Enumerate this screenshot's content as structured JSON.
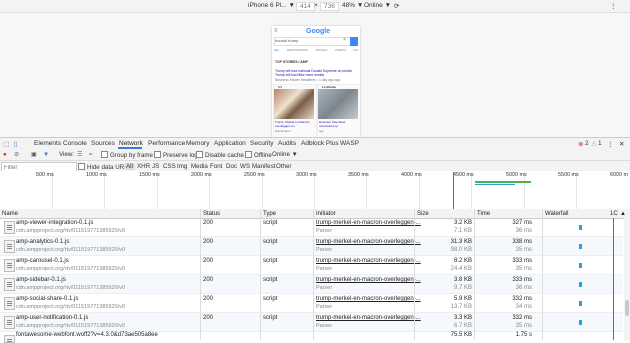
{
  "device_toolbar": {
    "device": "iPhone 6 Pl... ▼",
    "width": "414",
    "times": "×",
    "height": "736",
    "zoom": "48% ▼",
    "network": "Online ▼"
  },
  "phone": {
    "logo": "Google",
    "search_value": "donald trump",
    "tabs": [
      "ALL",
      "NEWS/IMAGES",
      "IMAGES",
      "VIDEOS",
      "MA"
    ],
    "section": "TOP STORIES / AMP",
    "story1": "Trump will lose national Donald Supreme on media Trump will lost Mike more worlds",
    "story1_src": "Business Insider Headlines • 1 day ago ago",
    "card_sources": [
      "NS",
      "Le Monde"
    ],
    "cap1": "Trump, Merkel en Macron: overleggen om",
    "cap2": "Directeur Tata Steel verrassend op",
    "cap1_src": "Washington",
    "cap2_src": "ago"
  },
  "devtools_tabs": [
    "Elements",
    "Console",
    "Sources",
    "Network",
    "Performance",
    "Memory",
    "Application",
    "Security",
    "Audits",
    "Adblock Plus",
    "WASP"
  ],
  "errors": "2",
  "warnings": "1",
  "net_toolbar": {
    "view": "View:",
    "group": "Group by frame",
    "preserve": "Preserve log",
    "cache": "Disable cache",
    "offline": "Offline",
    "online": "Online ▼"
  },
  "filter": {
    "placeholder": "Filter",
    "hide_data": "Hide data URLs",
    "types": [
      "All",
      "XHR",
      "JS",
      "CSS",
      "Img",
      "Media",
      "Font",
      "Doc",
      "WS",
      "Manifest",
      "Other"
    ]
  },
  "timeline_ticks": [
    "500 ms",
    "1000 ms",
    "1500 ms",
    "2000 ms",
    "2500 ms",
    "3000 ms",
    "3500 ms",
    "4000 ms",
    "4500 ms",
    "5000 ms",
    "5500 ms",
    "6000 m"
  ],
  "columns": {
    "name": "Name",
    "status": "Status",
    "type": "Type",
    "initiator": "Initiator",
    "size": "Size",
    "time": "Time",
    "waterfall": "Waterfall",
    "sort": "1C"
  },
  "rows": [
    {
      "name": "amp-viewer-integration-0.1.js",
      "domain": "cdn.ampproject.org/rtv/011519771385920/v0",
      "status": "200",
      "type": "script",
      "initiator": "trump-merkel-en-macron-overleggen-...",
      "initiator_sub": "Parser",
      "size": "3.2 KB",
      "size2": "7.1 KB",
      "time": "327 ms",
      "time2": "36 ms"
    },
    {
      "name": "amp-analytics-0.1.js",
      "domain": "cdn.ampproject.org/rtv/011519771385920/v0",
      "status": "200",
      "type": "script",
      "initiator": "trump-merkel-en-macron-overleggen-...",
      "initiator_sub": "Parser",
      "size": "31.3 KB",
      "size2": "98.0 KB",
      "time": "338 ms",
      "time2": "35 ms"
    },
    {
      "name": "amp-carousel-0.1.js",
      "domain": "cdn.ampproject.org/rtv/011519771385920/v0",
      "status": "200",
      "type": "script",
      "initiator": "trump-merkel-en-macron-overleggen-...",
      "initiator_sub": "Parser",
      "size": "8.2 KB",
      "size2": "24.4 KB",
      "time": "333 ms",
      "time2": "35 ms"
    },
    {
      "name": "amp-sidebar-0.1.js",
      "domain": "cdn.ampproject.org/rtv/011519771385920/v0",
      "status": "200",
      "type": "script",
      "initiator": "trump-merkel-en-macron-overleggen-...",
      "initiator_sub": "Parser",
      "size": "3.8 KB",
      "size2": "9.7 KB",
      "time": "333 ms",
      "time2": "36 ms"
    },
    {
      "name": "amp-social-share-0.1.js",
      "domain": "cdn.ampproject.org/rtv/011519771385920/v0",
      "status": "200",
      "type": "script",
      "initiator": "trump-merkel-en-macron-overleggen-...",
      "initiator_sub": "Parser",
      "size": "5.9 KB",
      "size2": "13.7 KB",
      "time": "332 ms",
      "time2": "34 ms"
    },
    {
      "name": "amp-user-notification-0.1.js",
      "domain": "cdn.ampproject.org/rtv/011519771385920/v0",
      "status": "200",
      "type": "script",
      "initiator": "trump-merkel-en-macron-overleggen-...",
      "initiator_sub": "Parser",
      "size": "3.3 KB",
      "size2": "6.7 KB",
      "time": "332 ms",
      "time2": "35 ms"
    },
    {
      "name": "fontawesome-webfont.woff2?v=4.3.0&d73ae505a8ee",
      "domain": "",
      "status": "",
      "type": "",
      "initiator": "",
      "initiator_sub": "",
      "size": "75.5 KB",
      "size2": "",
      "time": "1.75 s",
      "time2": ""
    }
  ],
  "colors": {
    "accent": "#3879d9",
    "record": "#d93025",
    "waterfall": "#2ba0d8"
  }
}
